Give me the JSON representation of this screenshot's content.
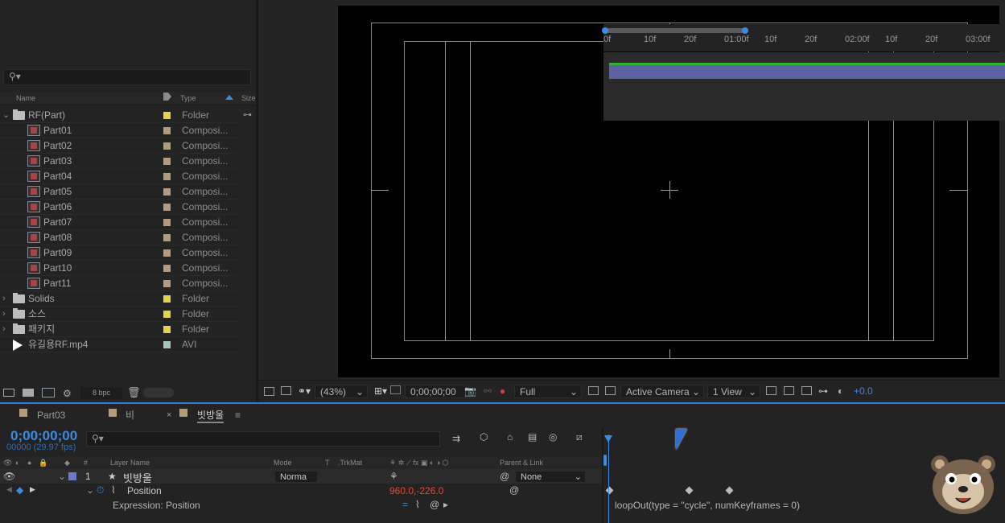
{
  "project": {
    "search_placeholder": "",
    "columns": {
      "name": "Name",
      "type": "Type",
      "size": "Size"
    },
    "items": [
      {
        "name": "RF(Part)",
        "type": "Folder",
        "kind": "folder",
        "expanded": true,
        "label_color": "#e3d24a"
      },
      {
        "name": "Part01",
        "type": "Composi...",
        "kind": "comp",
        "label_color": "#b49b7a"
      },
      {
        "name": "Part02",
        "type": "Composi...",
        "kind": "comp",
        "label_color": "#b49b7a"
      },
      {
        "name": "Part03",
        "type": "Composi...",
        "kind": "comp",
        "label_color": "#b49b7a"
      },
      {
        "name": "Part04",
        "type": "Composi...",
        "kind": "comp",
        "label_color": "#b49b7a"
      },
      {
        "name": "Part05",
        "type": "Composi...",
        "kind": "comp",
        "label_color": "#b49b7a"
      },
      {
        "name": "Part06",
        "type": "Composi...",
        "kind": "comp",
        "label_color": "#b49b7a"
      },
      {
        "name": "Part07",
        "type": "Composi...",
        "kind": "comp",
        "label_color": "#b49b7a"
      },
      {
        "name": "Part08",
        "type": "Composi...",
        "kind": "comp",
        "label_color": "#b49b7a"
      },
      {
        "name": "Part09",
        "type": "Composi...",
        "kind": "comp",
        "label_color": "#b49b7a"
      },
      {
        "name": "Part10",
        "type": "Composi...",
        "kind": "comp",
        "label_color": "#b49b7a"
      },
      {
        "name": "Part11",
        "type": "Composi...",
        "kind": "comp",
        "label_color": "#b49b7a"
      },
      {
        "name": "Solids",
        "type": "Folder",
        "kind": "folder",
        "expanded": false,
        "label_color": "#e3d24a"
      },
      {
        "name": "소스",
        "type": "Folder",
        "kind": "folder",
        "expanded": false,
        "label_color": "#e3d24a"
      },
      {
        "name": "패키지",
        "type": "Folder",
        "kind": "folder",
        "expanded": false,
        "label_color": "#e3d24a"
      },
      {
        "name": "유길용RF.mp4",
        "type": "AVI",
        "kind": "video",
        "label_color": "#a4c4c4"
      }
    ],
    "footer": {
      "bpc": "8 bpc"
    }
  },
  "viewer": {
    "zoom": "(43%)",
    "timecode": "0;00;00;00",
    "resolution": "Full",
    "camera": "Active Camera",
    "views": "1 View",
    "exposure": "+0.0"
  },
  "timeline": {
    "tabs": [
      {
        "label": "Part03",
        "color": "#b49b7a",
        "active": false
      },
      {
        "label": "비",
        "color": "#b49b7a",
        "active": false
      },
      {
        "label": "빗방울",
        "color": "#b49b7a",
        "active": true
      }
    ],
    "timecode": "0;00;00;00",
    "fps": "00000 (29.97 fps)",
    "columns": {
      "hash": "#",
      "layer_name": "Layer Name",
      "mode": "Mode",
      "t": "T",
      "trkmat": ".TrkMat",
      "parent": "Parent & Link"
    },
    "layer": {
      "index": "1",
      "name": "빗방울",
      "mode": "Norma",
      "parent": "None",
      "color": "#6e78c8"
    },
    "position": {
      "label": "Position",
      "value": "960.0,-226.0"
    },
    "expression": {
      "label": "Expression: Position",
      "code": "loopOut(type = \"cycle\", numKeyframes = 0)"
    },
    "ruler_ticks": [
      "0f",
      "10f",
      "20f",
      "01:00f",
      "10f",
      "20f",
      "02:00f",
      "10f",
      "20f",
      "03:00f"
    ],
    "colors": {
      "accent": "#3b8be0",
      "layer_bar": "#5a62a4",
      "green": "#2fb234",
      "value_red": "#e04a3a"
    }
  }
}
